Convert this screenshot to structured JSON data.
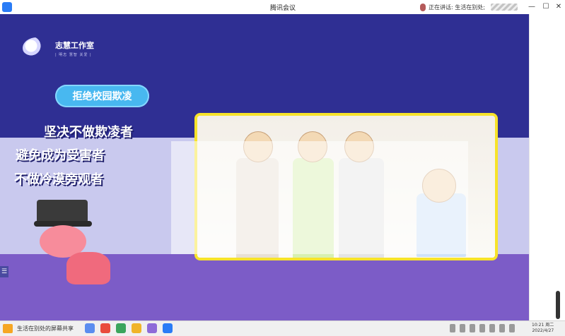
{
  "window": {
    "title": "腾讯会议",
    "speaking_label": "正在讲话: 生活在别处;",
    "controls": {
      "minimize": "—",
      "maximize": "☐",
      "close": "✕"
    }
  },
  "slide": {
    "logo_name": "志慧工作室",
    "logo_sub": "| 明志  慧智  关爱 |",
    "pill": "拒绝校园欺凌",
    "slogans": [
      "坚决不做欺凌者",
      "避免成为受害者",
      "不做冷漠旁观者"
    ]
  },
  "side_tab": "☰",
  "taskbar": {
    "share_message": "生活在别处的屏幕共享",
    "clock_time": "10:21 周二",
    "clock_date": "2022/4/27"
  },
  "colors": {
    "slide_top": "#2f2f93",
    "slide_mid": "#c9c9ee",
    "slide_bottom": "#7c5cc7",
    "pill": "#48b8f0",
    "frame": "#f7e32a"
  }
}
